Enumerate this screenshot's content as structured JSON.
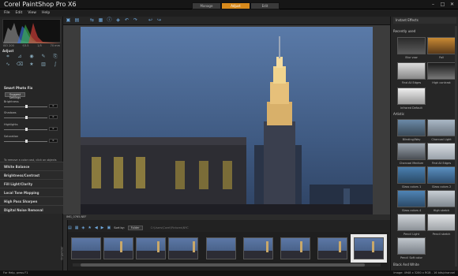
{
  "app": {
    "title": "Corel PaintShop Pro X6",
    "tabs": [
      {
        "label": "Manage",
        "active": false
      },
      {
        "label": "Adjust",
        "active": true
      },
      {
        "label": "Edit",
        "active": false
      }
    ],
    "accent_color": "#d88a1c"
  },
  "menu": [
    "File",
    "Edit",
    "View",
    "Help"
  ],
  "histogram": {
    "readouts": [
      "ISO 200",
      "f/3.5",
      "1/5",
      "70 mm"
    ]
  },
  "left_panel": {
    "header": "Adjust",
    "smart_photo_fix": {
      "title": "Smart Photo Fix",
      "suggest_label": "Suggest Settings"
    },
    "sliders": [
      {
        "label": "Brightness",
        "value": "0",
        "position": 0.5
      },
      {
        "label": "Shadows",
        "value": "0",
        "position": 0.5
      },
      {
        "label": "Highlights",
        "value": "0",
        "position": 0.5
      },
      {
        "label": "Saturation",
        "value": "0",
        "position": 0.5
      }
    ],
    "tip": "To remove a color cast, click on objects that should be black, white, or gray in the image. To remove a sampling point, click the image.",
    "sections": [
      "White Balance",
      "Brightness/Contrast",
      "Fill Light/Clarity",
      "Local Tone Mapping",
      "High Pass Sharpen",
      "Digital Noise Removal"
    ]
  },
  "canvas": {
    "filename": "IMG_0765.NEF"
  },
  "organizer": {
    "sort_label": "Sort by:",
    "sort_value": "Folder",
    "path_text": "C:\\Users\\Corel\\Pictures\\NYC",
    "side_label": "Organizer"
  },
  "right_panel": {
    "header": "Instant Effects",
    "groups": [
      {
        "name": "Recently used",
        "effects": [
          "Blur vow",
          "Fall",
          "Find All Edges",
          "High contrast",
          "Infrared Default"
        ]
      },
      {
        "name": "Artistic",
        "effects": [
          "Blinding/Way",
          "Charcoal Light",
          "Charcoal Medium",
          "Find All Edges",
          "Glass colors 1",
          "Glass colors 2",
          "Glass colors 4",
          "High sketch",
          "Pencil Light",
          "Pencil sketch",
          "Pencil Edges",
          "Pencil Light color",
          "Pencil Soft color"
        ]
      },
      {
        "name": "Black And White",
        "effects": []
      }
    ]
  },
  "status": {
    "left": "For Help, press F1",
    "right": "Image: 4948 x 3280 x RGB - 16 bits/channel"
  }
}
